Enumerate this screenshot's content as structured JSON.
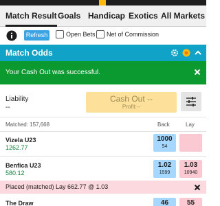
{
  "tabs": [
    {
      "label": "Match Result",
      "active": true
    },
    {
      "label": "Goals",
      "active": false
    },
    {
      "label": "Handicap",
      "active": false
    },
    {
      "label": "Exotics",
      "active": false
    },
    {
      "label": "All Markets",
      "active": false
    }
  ],
  "toolbar": {
    "info_icon": "info-icon",
    "refresh_label": "Refresh",
    "open_bets_label": "Open Bets",
    "open_bets_checked": false,
    "net_commission_label": "Net of Commission",
    "net_commission_checked": false
  },
  "market": {
    "title": "Match Odds",
    "icons": [
      "settings-gear-icon",
      "live-indicator-icon",
      "chevron-up-icon"
    ]
  },
  "cashout_banner": {
    "message": "Your Cash Out was successful.",
    "close_icon": "close-icon"
  },
  "cashout_panel": {
    "liability_label": "Liability",
    "liability_value": "--",
    "button_label": "Cash Out --",
    "button_profit": "Profit:--",
    "settings_icon": "sliders-icon"
  },
  "market_info": {
    "matched_label": "Matched: 157,668",
    "back_header": "Back",
    "lay_header": "Lay"
  },
  "runners": [
    {
      "name": "Vizela U23",
      "pl": "1262.77",
      "back_price": "1000",
      "back_size": "54",
      "lay_price": "",
      "lay_size": ""
    },
    {
      "name": "Benfica U23",
      "pl": "580.12",
      "back_price": "1.02",
      "back_size": "1599",
      "lay_price": "1.03",
      "lay_size": "10940"
    },
    {
      "name": "The Draw",
      "pl": "",
      "back_price": "46",
      "back_size": "",
      "lay_price": "55",
      "lay_size": ""
    }
  ],
  "bet_banner": {
    "message": "Placed (matched) Lay 662.77 @ 1.03",
    "close_icon": "close-icon"
  },
  "colors": {
    "market_header": "#10a2c7",
    "success_banner": "#0b9a30",
    "cashout_button": "#fde19a",
    "back_odds": "#a6d8ff",
    "lay_odds": "#fac9d1",
    "refresh_button": "#3aa3e3",
    "profit_text": "#15803d"
  }
}
